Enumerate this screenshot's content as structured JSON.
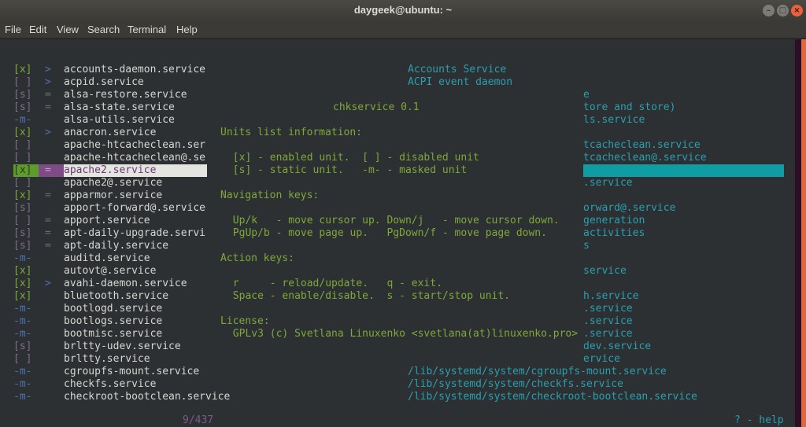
{
  "window": {
    "title": "daygeek@ubuntu: ~",
    "minimize_icon": "minimize-icon",
    "maximize_icon": "maximize-icon",
    "close_icon": "close-icon"
  },
  "menubar": [
    "File",
    "Edit",
    "View",
    "Search",
    "Terminal",
    "Help"
  ],
  "units": [
    {
      "mark": "[x]",
      "state": "x",
      "arrow": ">",
      "name": "accounts-daemon.service"
    },
    {
      "mark": "[ ]",
      "state": "d",
      "arrow": ">",
      "name": "acpid.service"
    },
    {
      "mark": "[s]",
      "state": "s",
      "arrow": "=",
      "name": "alsa-restore.service"
    },
    {
      "mark": "[s]",
      "state": "s",
      "arrow": "=",
      "name": "alsa-state.service"
    },
    {
      "mark": "-m-",
      "state": "m",
      "arrow": "",
      "name": "alsa-utils.service"
    },
    {
      "mark": "[x]",
      "state": "x",
      "arrow": ">",
      "name": "anacron.service"
    },
    {
      "mark": "[ ]",
      "state": "d",
      "arrow": "",
      "name": "apache-htcacheclean.ser"
    },
    {
      "mark": "[ ]",
      "state": "d",
      "arrow": "",
      "name": "apache-htcacheclean@.se"
    },
    {
      "mark": "[x]",
      "state": "x",
      "arrow": "=",
      "name": "apache2.service",
      "selected": true
    },
    {
      "mark": "[ ]",
      "state": "d",
      "arrow": "",
      "name": "apache2@.service"
    },
    {
      "mark": "[x]",
      "state": "x",
      "arrow": "=",
      "name": "apparmor.service"
    },
    {
      "mark": "[s]",
      "state": "s",
      "arrow": "",
      "name": "apport-forward@.service"
    },
    {
      "mark": "[ ]",
      "state": "d",
      "arrow": "=",
      "name": "apport.service"
    },
    {
      "mark": "[s]",
      "state": "s",
      "arrow": "=",
      "name": "apt-daily-upgrade.servi"
    },
    {
      "mark": "[s]",
      "state": "s",
      "arrow": "=",
      "name": "apt-daily.service"
    },
    {
      "mark": "-m-",
      "state": "m",
      "arrow": "",
      "name": "auditd.service"
    },
    {
      "mark": "[x]",
      "state": "x",
      "arrow": "",
      "name": "autovt@.service"
    },
    {
      "mark": "[x]",
      "state": "x",
      "arrow": ">",
      "name": "avahi-daemon.service"
    },
    {
      "mark": "[x]",
      "state": "x",
      "arrow": "",
      "name": "bluetooth.service"
    },
    {
      "mark": "-m-",
      "state": "m",
      "arrow": "",
      "name": "bootlogd.service"
    },
    {
      "mark": "-m-",
      "state": "m",
      "arrow": "",
      "name": "bootlogs.service"
    },
    {
      "mark": "-m-",
      "state": "m",
      "arrow": "",
      "name": "bootmisc.service"
    },
    {
      "mark": "[s]",
      "state": "s",
      "arrow": "",
      "name": "brltty-udev.service"
    },
    {
      "mark": "[ ]",
      "state": "d",
      "arrow": "",
      "name": "brltty.service"
    },
    {
      "mark": "-m-",
      "state": "m",
      "arrow": "",
      "name": "cgroupfs-mount.service"
    },
    {
      "mark": "-m-",
      "state": "m",
      "arrow": "",
      "name": "checkfs.service"
    },
    {
      "mark": "-m-",
      "state": "m",
      "arrow": "",
      "name": "checkroot-bootclean.service"
    }
  ],
  "descriptions": [
    {
      "row": 0,
      "col": "a",
      "text": "Accounts Service"
    },
    {
      "row": 1,
      "col": "a",
      "text": "ACPI event daemon"
    },
    {
      "row": 2,
      "col": "b",
      "text": "e"
    },
    {
      "row": 3,
      "col": "b",
      "text": "tore and store)"
    },
    {
      "row": 4,
      "col": "b",
      "text": "ls.service"
    },
    {
      "row": 6,
      "col": "b",
      "text": "tcacheclean.service"
    },
    {
      "row": 7,
      "col": "b",
      "text": "tcacheclean@.service"
    },
    {
      "row": 9,
      "col": "b",
      "text": ".service"
    },
    {
      "row": 11,
      "col": "b",
      "text": "orward@.service"
    },
    {
      "row": 12,
      "col": "b",
      "text": "generation"
    },
    {
      "row": 13,
      "col": "b",
      "text": "activities"
    },
    {
      "row": 14,
      "col": "b",
      "text": "s"
    },
    {
      "row": 16,
      "col": "b",
      "text": "service"
    },
    {
      "row": 18,
      "col": "b",
      "text": "h.service"
    },
    {
      "row": 19,
      "col": "b",
      "text": ".service"
    },
    {
      "row": 20,
      "col": "b",
      "text": ".service"
    },
    {
      "row": 21,
      "col": "b",
      "text": ".service"
    },
    {
      "row": 22,
      "col": "b",
      "text": "dev.service"
    },
    {
      "row": 23,
      "col": "b",
      "text": "ervice"
    },
    {
      "row": 24,
      "col": "a",
      "text": "/lib/systemd/system/cgroupfs-mount.service"
    },
    {
      "row": 25,
      "col": "a",
      "text": "/lib/systemd/system/checkfs.service"
    },
    {
      "row": 26,
      "col": "a",
      "text": "/lib/systemd/system/checkroot-bootclean.service"
    }
  ],
  "help": {
    "title": "chkservice 0.1",
    "lines": [
      {
        "row": 5,
        "indent": 0,
        "text": "Units list information:"
      },
      {
        "row": 7,
        "indent": 2,
        "text": "[x] - enabled unit.  [ ] - disabled unit"
      },
      {
        "row": 8,
        "indent": 2,
        "text": "[s] - static unit.   -m- - masked unit"
      },
      {
        "row": 10,
        "indent": 0,
        "text": "Navigation keys:"
      },
      {
        "row": 12,
        "indent": 2,
        "text": "Up/k   - move cursor up. Down/j   - move cursor down."
      },
      {
        "row": 13,
        "indent": 2,
        "text": "PgUp/b - move page up.   PgDown/f - move page down."
      },
      {
        "row": 15,
        "indent": 0,
        "text": "Action keys:"
      },
      {
        "row": 17,
        "indent": 2,
        "text": "r     - reload/update.   q - exit."
      },
      {
        "row": 18,
        "indent": 2,
        "text": "Space - enable/disable.  s - start/stop unit."
      },
      {
        "row": 20,
        "indent": 0,
        "text": "License:"
      },
      {
        "row": 21,
        "indent": 2,
        "text": "GPLv3 (c) Svetlana Linuxenko <svetlana(at)linuxenko.pro>"
      }
    ]
  },
  "status": {
    "position": "9/437",
    "help_hint": "? - help"
  },
  "colors": {
    "enabled": "#7fa83a",
    "disabled": "#7d6d8c",
    "masked": "#4f72b0",
    "description": "#2a9fae",
    "selection": "#7e4b86",
    "selection_right": "#0f9da3"
  }
}
